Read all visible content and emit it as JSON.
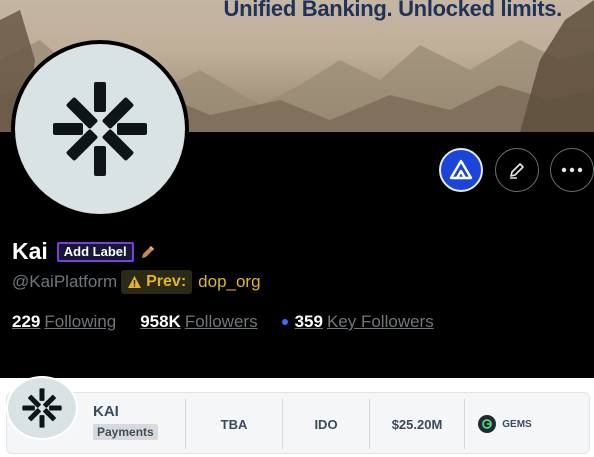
{
  "banner": {
    "tagline": "Unified Banking. Unlocked limits."
  },
  "profile": {
    "display_name": "Kai",
    "add_label": "Add Label",
    "handle": "@KaiPlatform",
    "prev_label": "Prev:",
    "prev_value": "dop_org"
  },
  "stats": {
    "following_count": "229",
    "following_label": "Following",
    "followers_count": "958K",
    "followers_label": "Followers",
    "key_followers_count": "359",
    "key_followers_label": "Key Followers"
  },
  "card": {
    "name": "KAI",
    "category": "Payments",
    "status": "TBA",
    "sale_type": "IDO",
    "raise": "$25.20M",
    "source": "GEMS"
  },
  "colors": {
    "brand_button": "#1a45d8",
    "label_border": "#7b3fe0",
    "prev_accent": "#e3b523",
    "key_dot": "#3a6dff"
  },
  "icons": {
    "brand_button": "triangle-logo-icon",
    "edit_button": "pencil-icon",
    "more_button": "more-dots-icon",
    "label_edit": "pencil-icon",
    "prev_warning": "warning-icon"
  }
}
